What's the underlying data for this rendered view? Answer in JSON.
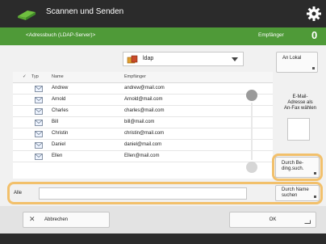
{
  "app": {
    "title": "Scannen und Senden",
    "icon": "scan-send-icon",
    "settings_icon": "gear-icon"
  },
  "header": {
    "breadcrumb": "<Adressbuch (LDAP-Server)>",
    "recipient_label": "Empfänger",
    "recipient_count": "0"
  },
  "address_book": {
    "selected": "ldap",
    "icon": "address-book-icon"
  },
  "table": {
    "headers": {
      "check": "✓",
      "type": "Typ",
      "name": "Name",
      "recipient": "Empfänger"
    },
    "rows": [
      {
        "name": "Andrew",
        "email": "andrew@mail.com"
      },
      {
        "name": "Arnold",
        "email": "Arnold@mail.com"
      },
      {
        "name": "Charles",
        "email": "charles@mail.com"
      },
      {
        "name": "Bill",
        "email": "bill@mail.com"
      },
      {
        "name": "Christin",
        "email": "christin@mail.com"
      },
      {
        "name": "Daniel",
        "email": "daniel@mail.com"
      },
      {
        "name": "Ellen",
        "email": "Ellen@mail.com"
      }
    ]
  },
  "side": {
    "to_local_label": "An Lokal",
    "set_email_line1": "E-Mail-",
    "set_email_line2": "Adresse als",
    "set_email_line3": "An-Fax wählen",
    "search_condition_line1": "Durch Be-",
    "search_condition_line2": "ding.such.",
    "search_name_line1": "Durch Name",
    "search_name_line2": "suchen"
  },
  "search": {
    "label": "Alle",
    "value": ""
  },
  "footer": {
    "cancel_label": "Abbrechen",
    "ok_label": "OK"
  },
  "colors": {
    "accent": "#4f9a38",
    "highlight": "#f2c06b",
    "titlebar": "#2b2b2b"
  }
}
